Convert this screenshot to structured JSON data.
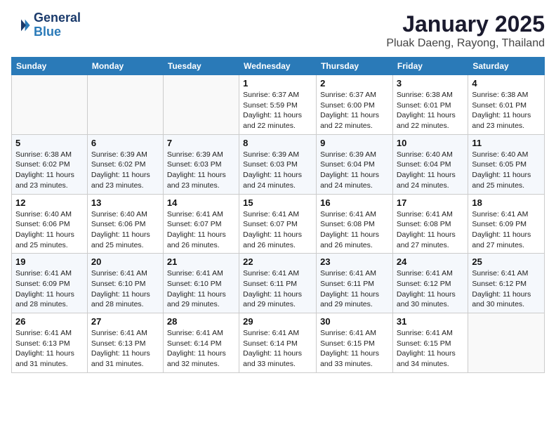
{
  "header": {
    "logo_general": "General",
    "logo_blue": "Blue",
    "month": "January 2025",
    "location": "Pluak Daeng, Rayong, Thailand"
  },
  "weekdays": [
    "Sunday",
    "Monday",
    "Tuesday",
    "Wednesday",
    "Thursday",
    "Friday",
    "Saturday"
  ],
  "weeks": [
    [
      {
        "day": "",
        "info": ""
      },
      {
        "day": "",
        "info": ""
      },
      {
        "day": "",
        "info": ""
      },
      {
        "day": "1",
        "info": "Sunrise: 6:37 AM\nSunset: 5:59 PM\nDaylight: 11 hours\nand 22 minutes."
      },
      {
        "day": "2",
        "info": "Sunrise: 6:37 AM\nSunset: 6:00 PM\nDaylight: 11 hours\nand 22 minutes."
      },
      {
        "day": "3",
        "info": "Sunrise: 6:38 AM\nSunset: 6:01 PM\nDaylight: 11 hours\nand 22 minutes."
      },
      {
        "day": "4",
        "info": "Sunrise: 6:38 AM\nSunset: 6:01 PM\nDaylight: 11 hours\nand 23 minutes."
      }
    ],
    [
      {
        "day": "5",
        "info": "Sunrise: 6:38 AM\nSunset: 6:02 PM\nDaylight: 11 hours\nand 23 minutes."
      },
      {
        "day": "6",
        "info": "Sunrise: 6:39 AM\nSunset: 6:02 PM\nDaylight: 11 hours\nand 23 minutes."
      },
      {
        "day": "7",
        "info": "Sunrise: 6:39 AM\nSunset: 6:03 PM\nDaylight: 11 hours\nand 23 minutes."
      },
      {
        "day": "8",
        "info": "Sunrise: 6:39 AM\nSunset: 6:03 PM\nDaylight: 11 hours\nand 24 minutes."
      },
      {
        "day": "9",
        "info": "Sunrise: 6:39 AM\nSunset: 6:04 PM\nDaylight: 11 hours\nand 24 minutes."
      },
      {
        "day": "10",
        "info": "Sunrise: 6:40 AM\nSunset: 6:04 PM\nDaylight: 11 hours\nand 24 minutes."
      },
      {
        "day": "11",
        "info": "Sunrise: 6:40 AM\nSunset: 6:05 PM\nDaylight: 11 hours\nand 25 minutes."
      }
    ],
    [
      {
        "day": "12",
        "info": "Sunrise: 6:40 AM\nSunset: 6:06 PM\nDaylight: 11 hours\nand 25 minutes."
      },
      {
        "day": "13",
        "info": "Sunrise: 6:40 AM\nSunset: 6:06 PM\nDaylight: 11 hours\nand 25 minutes."
      },
      {
        "day": "14",
        "info": "Sunrise: 6:41 AM\nSunset: 6:07 PM\nDaylight: 11 hours\nand 26 minutes."
      },
      {
        "day": "15",
        "info": "Sunrise: 6:41 AM\nSunset: 6:07 PM\nDaylight: 11 hours\nand 26 minutes."
      },
      {
        "day": "16",
        "info": "Sunrise: 6:41 AM\nSunset: 6:08 PM\nDaylight: 11 hours\nand 26 minutes."
      },
      {
        "day": "17",
        "info": "Sunrise: 6:41 AM\nSunset: 6:08 PM\nDaylight: 11 hours\nand 27 minutes."
      },
      {
        "day": "18",
        "info": "Sunrise: 6:41 AM\nSunset: 6:09 PM\nDaylight: 11 hours\nand 27 minutes."
      }
    ],
    [
      {
        "day": "19",
        "info": "Sunrise: 6:41 AM\nSunset: 6:09 PM\nDaylight: 11 hours\nand 28 minutes."
      },
      {
        "day": "20",
        "info": "Sunrise: 6:41 AM\nSunset: 6:10 PM\nDaylight: 11 hours\nand 28 minutes."
      },
      {
        "day": "21",
        "info": "Sunrise: 6:41 AM\nSunset: 6:10 PM\nDaylight: 11 hours\nand 29 minutes."
      },
      {
        "day": "22",
        "info": "Sunrise: 6:41 AM\nSunset: 6:11 PM\nDaylight: 11 hours\nand 29 minutes."
      },
      {
        "day": "23",
        "info": "Sunrise: 6:41 AM\nSunset: 6:11 PM\nDaylight: 11 hours\nand 29 minutes."
      },
      {
        "day": "24",
        "info": "Sunrise: 6:41 AM\nSunset: 6:12 PM\nDaylight: 11 hours\nand 30 minutes."
      },
      {
        "day": "25",
        "info": "Sunrise: 6:41 AM\nSunset: 6:12 PM\nDaylight: 11 hours\nand 30 minutes."
      }
    ],
    [
      {
        "day": "26",
        "info": "Sunrise: 6:41 AM\nSunset: 6:13 PM\nDaylight: 11 hours\nand 31 minutes."
      },
      {
        "day": "27",
        "info": "Sunrise: 6:41 AM\nSunset: 6:13 PM\nDaylight: 11 hours\nand 31 minutes."
      },
      {
        "day": "28",
        "info": "Sunrise: 6:41 AM\nSunset: 6:14 PM\nDaylight: 11 hours\nand 32 minutes."
      },
      {
        "day": "29",
        "info": "Sunrise: 6:41 AM\nSunset: 6:14 PM\nDaylight: 11 hours\nand 33 minutes."
      },
      {
        "day": "30",
        "info": "Sunrise: 6:41 AM\nSunset: 6:15 PM\nDaylight: 11 hours\nand 33 minutes."
      },
      {
        "day": "31",
        "info": "Sunrise: 6:41 AM\nSunset: 6:15 PM\nDaylight: 11 hours\nand 34 minutes."
      },
      {
        "day": "",
        "info": ""
      }
    ]
  ]
}
